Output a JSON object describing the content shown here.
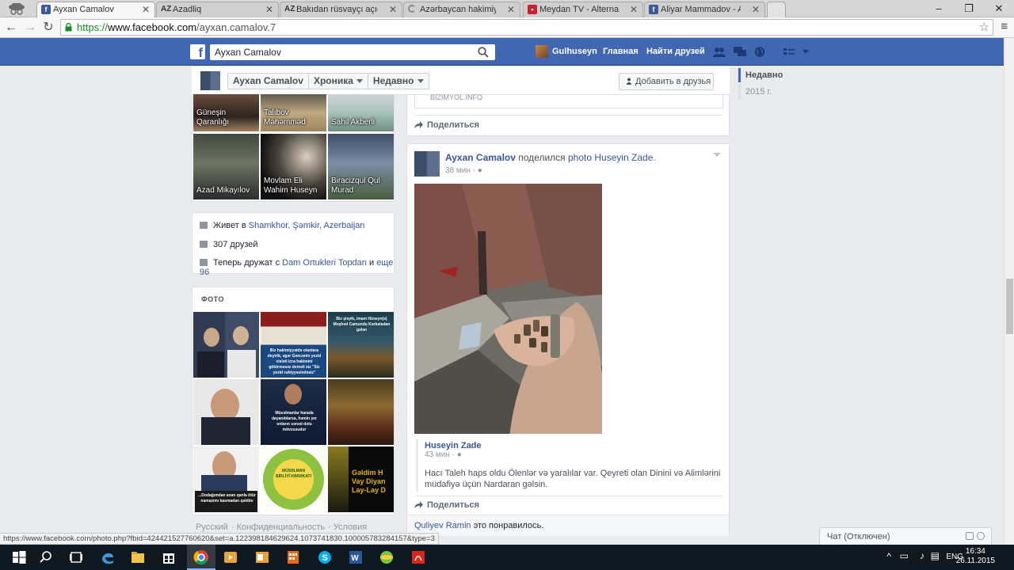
{
  "browser": {
    "tabs": [
      {
        "title": "Ayxan Camalov",
        "icon": "facebook-icon",
        "active": true
      },
      {
        "title": "Azadliq",
        "icon": "az-icon"
      },
      {
        "title": "Bakıdan rüsvayçı açıqlama",
        "icon": "az-icon"
      },
      {
        "title": "Azərbaycan hakimiyyətinin",
        "icon": "loading-icon"
      },
      {
        "title": "Meydan TV - Alternativ va",
        "icon": "meydan-icon"
      },
      {
        "title": "Aliyar Mammadov - Aliyar",
        "icon": "facebook-icon"
      }
    ],
    "url_scheme": "https://",
    "url_domain": "www.facebook.com",
    "url_path": "/ayxan.camalov.7",
    "status_url": "https://www.facebook.com/photo.php?fbid=424421527760620&set=a.122398184629624.1073741830.100005783284157&type=3"
  },
  "fb_header": {
    "search_value": "Ayxan Camalov",
    "user_name": "Gulhuseyn",
    "nav_home": "Главная",
    "nav_find_friends": "Найти друзей"
  },
  "timeline_header": {
    "name": "Ayxan Camalov",
    "chronicle": "Хроника",
    "recent": "Недавно",
    "add_friend": "Добавить в друзья"
  },
  "scrubber": {
    "current": "Недавно",
    "year": "2015 г."
  },
  "friends": [
    {
      "name": "Güneşin Qaranlığı"
    },
    {
      "name": "Talıbov Məhəmməd"
    },
    {
      "name": "Sahil Akberli"
    },
    {
      "name": "Azad Mikayılov"
    },
    {
      "name": "Movlam Eli Wahim Huseyn"
    },
    {
      "name": "Biracizqul Qul Murad"
    }
  ],
  "intro": {
    "lives_prefix": "Живет в ",
    "lives_place": "Shamkhor, Şəmkir, Azerbaijan",
    "friends_count": "307 друзей",
    "now_friends_prefix": "Теперь дружат с ",
    "now_friends_name": "Dam Ortukleri Topdan",
    "now_friends_mid": " и ",
    "now_friends_more": "еще 96"
  },
  "photos": {
    "heading": "ФОТО",
    "captions": [
      "",
      "Biz hakimiyyətdə olanlara deyirik, əgər Gəncənin yezid xisləti icra hakimini götürməsəz deməli siz \"Siz yezid ruhiyyəsindəsiz\"",
      "Biz şiəyik, imam Hüseyn(ə) Məşhəd Camundu Kərbəladan gələn",
      "",
      "Müsəlmanlar harada dayanıblarsa, həmin yer onların sənəd dolu mövzusudur",
      "",
      "...Dodağımdan axan qanla ötür namazımı kasmadan qəldim",
      "MÜSƏLMAN BİRLİYİ HƏRƏKATI",
      "Gəldim H Vay Diyan Lay-Lay D"
    ]
  },
  "footer": {
    "links": [
      "Русский",
      "Конфиденциальность",
      "Условия"
    ]
  },
  "postA": {
    "source": "BIZIMYOL.INFO",
    "share": "Поделиться"
  },
  "postB": {
    "author": "Ayxan Camalov",
    "action": " поделился ",
    "object": "photo Huseyin Zade.",
    "time": "38 мин",
    "quote_name": "Huseyin Zade",
    "quote_time": "43 мин",
    "quote_text": "Hacı Taleh haps oldu Ölenlər və yaralılar var. Qeyreti olan Dinini və Alimlərini müdafiyə üçün Nardaran gəlsin.",
    "share": "Поделиться",
    "liker": "Quliyev Ramin",
    "likes_suffix": " это понравилось."
  },
  "chat": {
    "label": "Чат (Отключен)"
  },
  "taskbar": {
    "lang": "ENG",
    "time": "16:34",
    "date": "26.11.2015"
  },
  "colors": {
    "fb_blue": "#4267b2",
    "link": "#365899",
    "taskbar": "#101820"
  }
}
